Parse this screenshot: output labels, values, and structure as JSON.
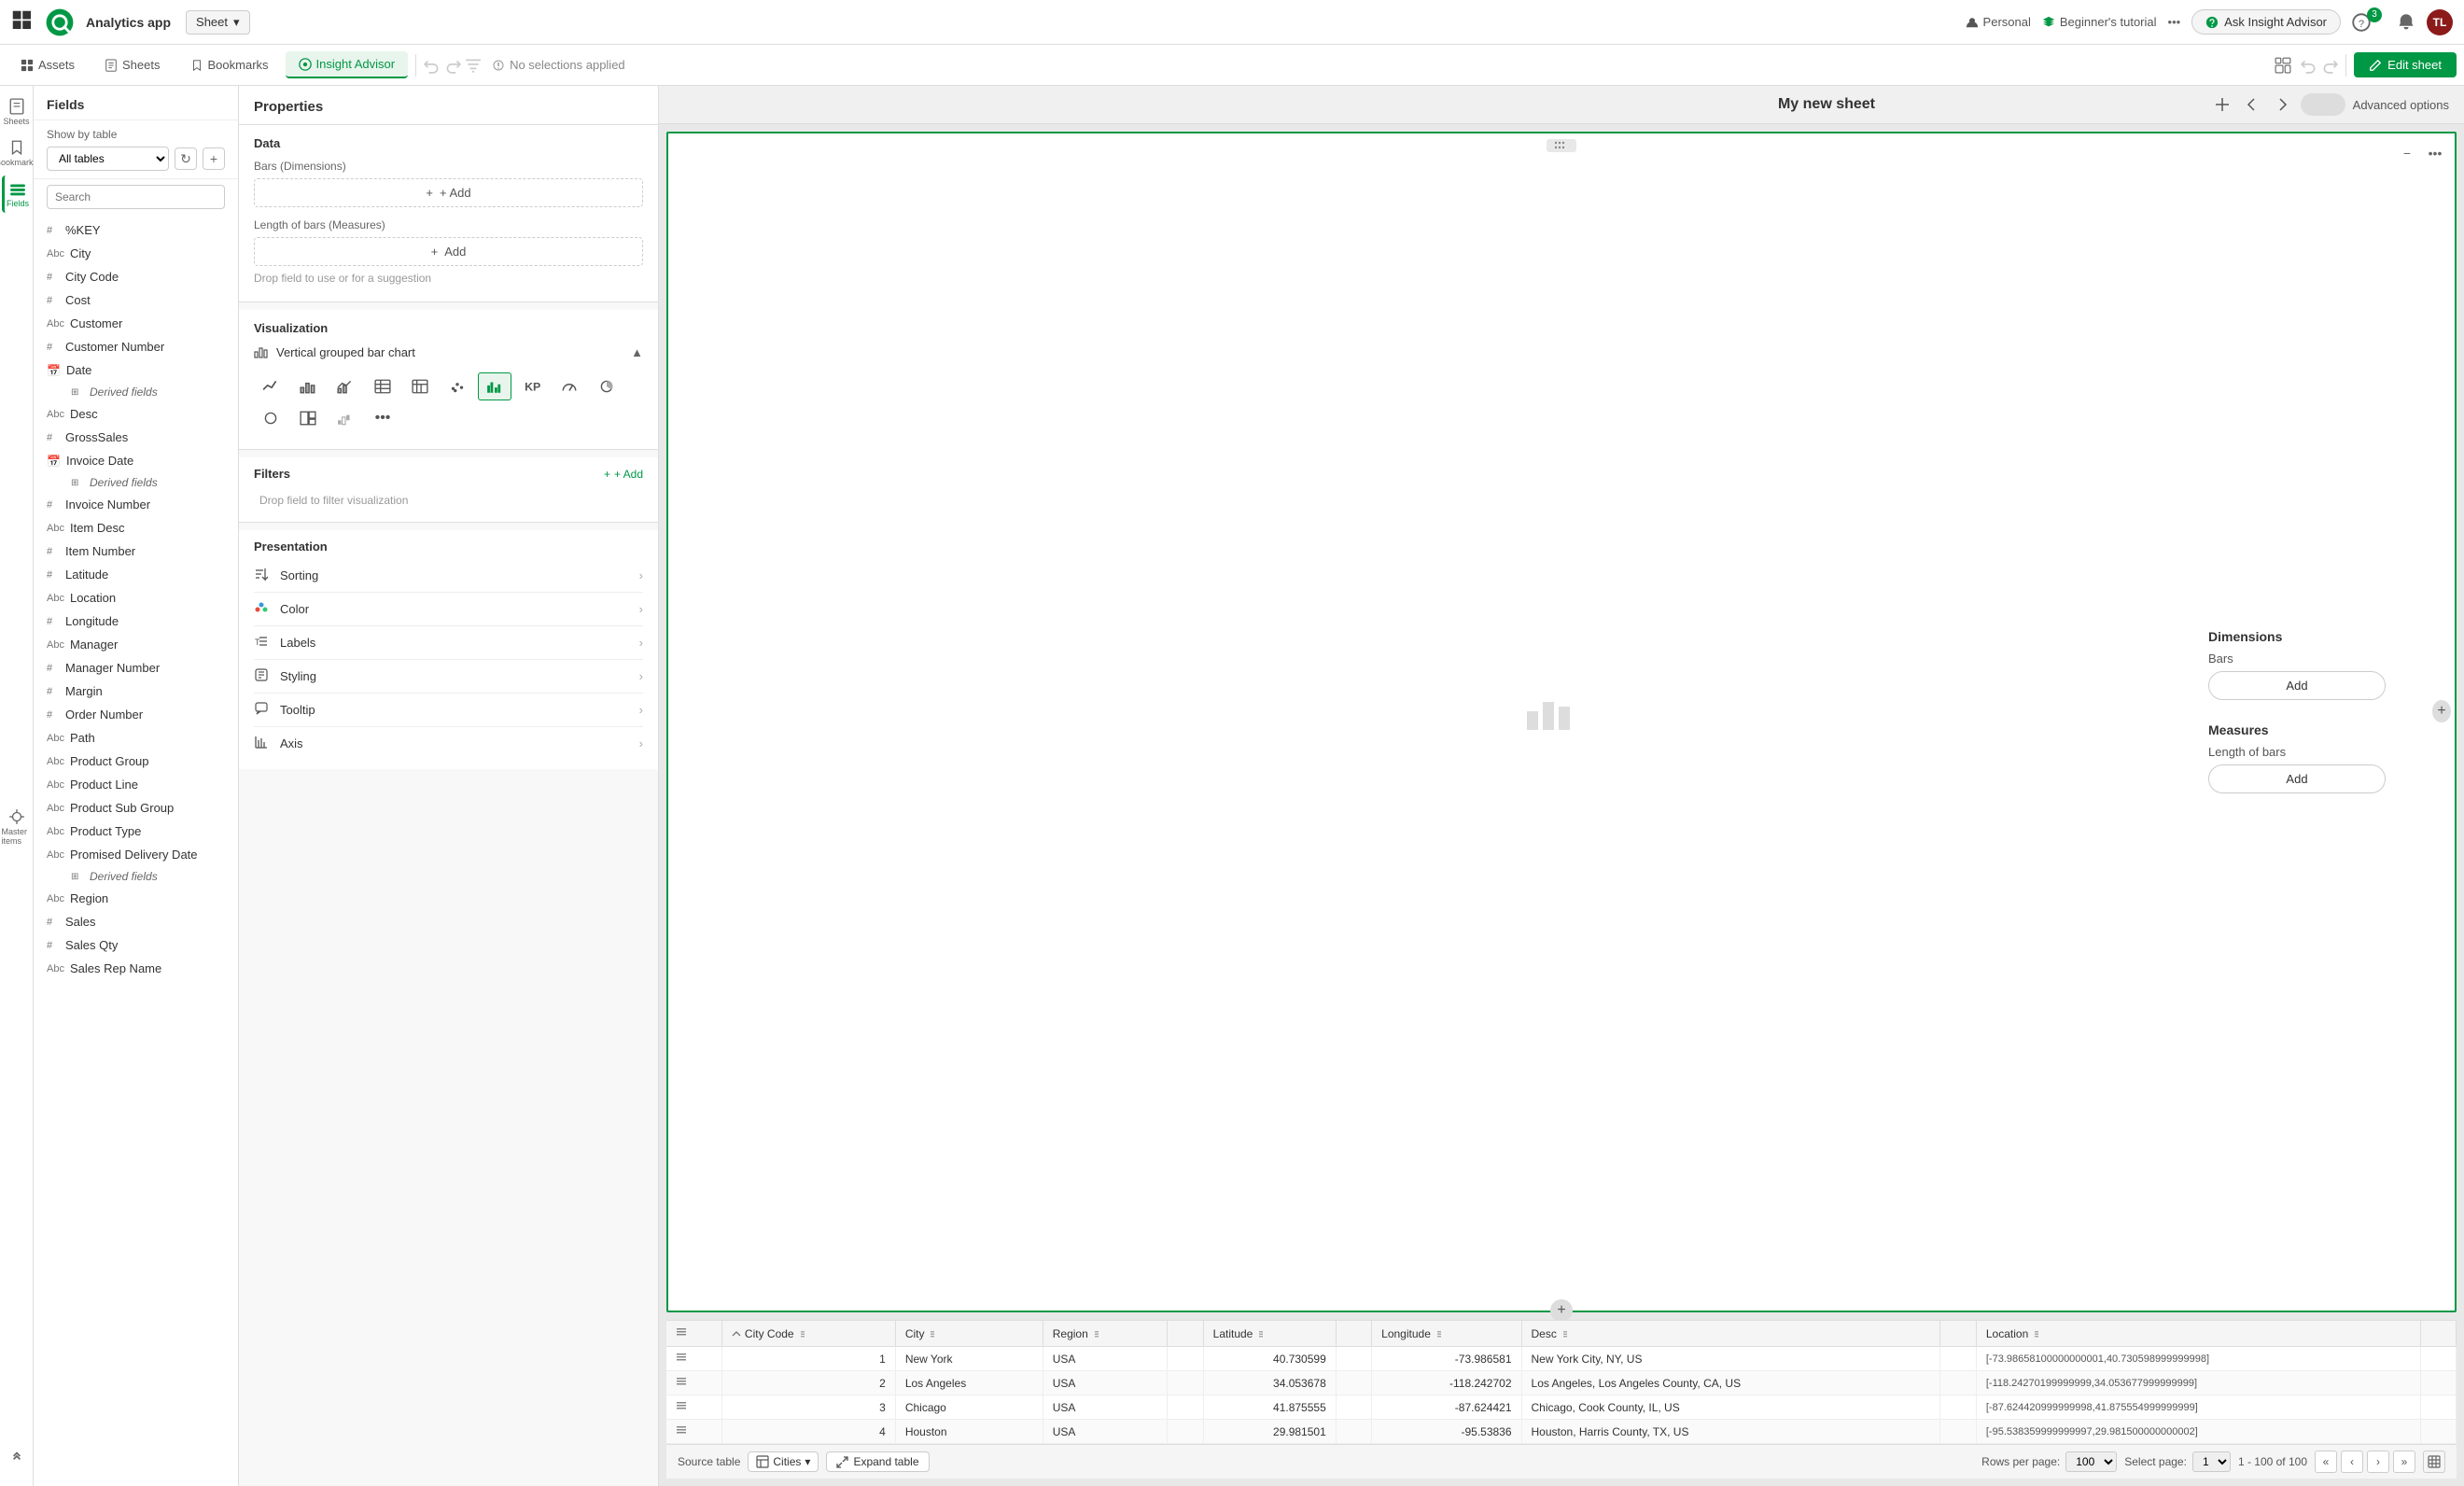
{
  "topNav": {
    "appGridLabel": "App grid",
    "logoText": "Qlik",
    "appName": "Analytics app",
    "sheetDropdown": "Sheet",
    "personalLabel": "Personal",
    "tutorialLabel": "Beginner's tutorial",
    "moreLabel": "...",
    "askInsightLabel": "Ask Insight Advisor",
    "notificationCount": "3",
    "avatarInitials": "TL"
  },
  "secondToolbar": {
    "assetsLabel": "Assets",
    "sheetsLabel": "Sheets",
    "bookmarksLabel": "Bookmarks",
    "insightAdvisorLabel": "Insight Advisor",
    "noSelections": "No selections applied",
    "editSheetLabel": "Edit sheet",
    "advancedOptionsLabel": "Advanced options"
  },
  "sidebar": {
    "items": [
      {
        "label": "Sheets",
        "icon": "sheets-icon"
      },
      {
        "label": "Bookmarks",
        "icon": "bookmarks-icon"
      },
      {
        "label": "Fields",
        "icon": "fields-icon"
      },
      {
        "label": "Master items",
        "icon": "master-items-icon"
      }
    ]
  },
  "fieldsPanel": {
    "title": "Fields",
    "showByTableLabel": "Show by table",
    "tableSelectValue": "All tables",
    "searchPlaceholder": "Search",
    "fields": [
      {
        "type": "#",
        "name": "%KEY"
      },
      {
        "type": "Abc",
        "name": "City"
      },
      {
        "type": "#",
        "name": "City Code"
      },
      {
        "type": "#",
        "name": "Cost"
      },
      {
        "type": "Abc",
        "name": "Customer"
      },
      {
        "type": "#",
        "name": "Customer Number"
      },
      {
        "type": "cal",
        "name": "Date"
      },
      {
        "type": "derived",
        "name": "Derived fields"
      },
      {
        "type": "Abc",
        "name": "Desc"
      },
      {
        "type": "#",
        "name": "GrossSales"
      },
      {
        "type": "cal",
        "name": "Invoice Date"
      },
      {
        "type": "derived",
        "name": "Derived fields"
      },
      {
        "type": "#",
        "name": "Invoice Number"
      },
      {
        "type": "Abc",
        "name": "Item Desc"
      },
      {
        "type": "#",
        "name": "Item Number"
      },
      {
        "type": "#",
        "name": "Latitude"
      },
      {
        "type": "Abc",
        "name": "Location"
      },
      {
        "type": "#",
        "name": "Longitude"
      },
      {
        "type": "Abc",
        "name": "Manager"
      },
      {
        "type": "#",
        "name": "Manager Number"
      },
      {
        "type": "#",
        "name": "Margin"
      },
      {
        "type": "#",
        "name": "Order Number"
      },
      {
        "type": "Abc",
        "name": "Path"
      },
      {
        "type": "Abc",
        "name": "Product Group"
      },
      {
        "type": "Abc",
        "name": "Product Line"
      },
      {
        "type": "Abc",
        "name": "Product Sub Group"
      },
      {
        "type": "Abc",
        "name": "Product Type"
      },
      {
        "type": "Abc",
        "name": "Promised Delivery Date"
      },
      {
        "type": "derived2",
        "name": "Derived fields"
      },
      {
        "type": "Abc",
        "name": "Region"
      },
      {
        "type": "#",
        "name": "Sales"
      },
      {
        "type": "#",
        "name": "Sales Qty"
      },
      {
        "type": "Abc",
        "name": "Sales Rep Name"
      }
    ]
  },
  "properties": {
    "title": "Properties",
    "dataSection": "Data",
    "barsLabel": "Bars (Dimensions)",
    "lengthLabel": "Length of bars (Measures)",
    "addLabel": "+ Add",
    "dropHint": "Drop field to use or for a suggestion",
    "vizLabel": "Visualization",
    "vizName": "Vertical grouped bar chart",
    "filtersTitle": "Filters",
    "filterHint": "+ Add",
    "dropFilterHint": "Drop field to filter visualization",
    "presentationTitle": "Presentation",
    "presItems": [
      {
        "label": "Sorting",
        "icon": "sorting-icon"
      },
      {
        "label": "Color",
        "icon": "color-icon"
      },
      {
        "label": "Labels",
        "icon": "labels-icon"
      },
      {
        "label": "Styling",
        "icon": "styling-icon"
      },
      {
        "label": "Tooltip",
        "icon": "tooltip-icon"
      },
      {
        "label": "Axis",
        "icon": "axis-icon"
      }
    ]
  },
  "sheet": {
    "title": "My new sheet",
    "advancedOptionsLabel": "Advanced options"
  },
  "vizCanvas": {
    "dimensions": "Dimensions",
    "barsLabel": "Bars",
    "addLabel": "Add",
    "measures": "Measures",
    "lengthLabel": "Length of bars",
    "addLabel2": "Add"
  },
  "dataTable": {
    "columns": [
      {
        "label": "City Code",
        "sortable": true
      },
      {
        "label": "City",
        "sortable": true
      },
      {
        "label": "Region",
        "sortable": true
      },
      {
        "label": "",
        "sortable": false
      },
      {
        "label": "Latitude",
        "sortable": true
      },
      {
        "label": "",
        "sortable": false
      },
      {
        "label": "Longitude",
        "sortable": true
      },
      {
        "label": "Desc",
        "sortable": true
      },
      {
        "label": "",
        "sortable": false
      },
      {
        "label": "Location",
        "sortable": true
      },
      {
        "label": "",
        "sortable": false
      }
    ],
    "rows": [
      {
        "cityCode": "1",
        "city": "New York",
        "region": "USA",
        "col4": "",
        "latitude": "40.730599",
        "col6": "",
        "longitude": "-73.986581",
        "desc": "New York City, NY, US",
        "col9": "",
        "location": "[-73.98658100000000001,40.730598999999998]",
        "col11": ""
      },
      {
        "cityCode": "2",
        "city": "Los Angeles",
        "region": "USA",
        "col4": "",
        "latitude": "34.053678",
        "col6": "",
        "longitude": "-118.242702",
        "desc": "Los Angeles, Los Angeles County, CA, US",
        "col9": "",
        "location": "[-118.24270199999999,34.053677999999999]",
        "col11": ""
      },
      {
        "cityCode": "3",
        "city": "Chicago",
        "region": "USA",
        "col4": "",
        "latitude": "41.875555",
        "col6": "",
        "longitude": "-87.624421",
        "desc": "Chicago, Cook County, IL, US",
        "col9": "",
        "location": "[-87.624420999999998,41.875554999999999]",
        "col11": ""
      },
      {
        "cityCode": "4",
        "city": "Houston",
        "region": "USA",
        "col4": "",
        "latitude": "29.981501",
        "col6": "",
        "longitude": "-95.53836",
        "desc": "Houston, Harris County, TX, US",
        "col9": "",
        "location": "[-95.538359999999997,29.981500000000002]",
        "col11": ""
      }
    ],
    "footer": {
      "sourceTableLabel": "Source table",
      "citiesLabel": "Cities",
      "expandTableLabel": "Expand table",
      "rowsPerPageLabel": "Rows per page:",
      "rowsPerPageValue": "100",
      "selectPageLabel": "Select page:",
      "currentPage": "1",
      "pageRange": "1 - 100 of 100"
    }
  }
}
